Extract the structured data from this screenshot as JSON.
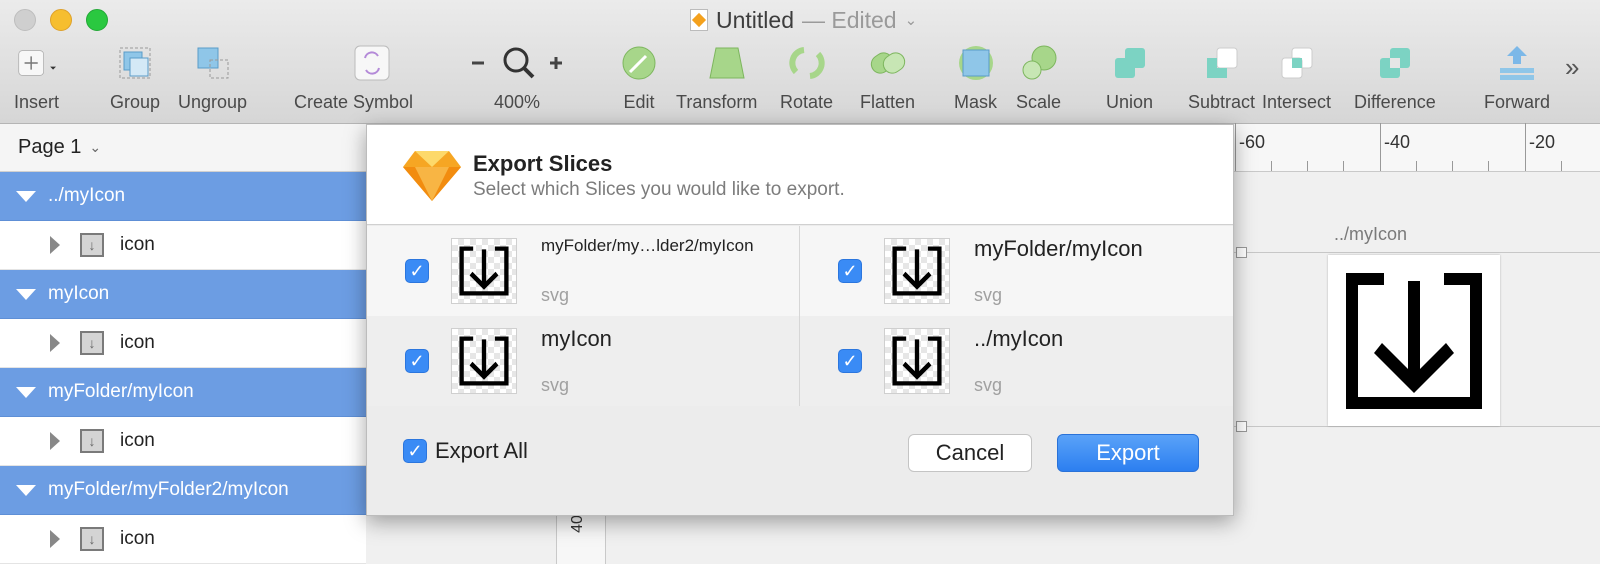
{
  "window": {
    "title": "Untitled",
    "edited": "— Edited"
  },
  "toolbar": {
    "insert": "Insert",
    "group": "Group",
    "ungroup": "Ungroup",
    "create_symbol": "Create Symbol",
    "zoom_level": "400%",
    "edit": "Edit",
    "transform": "Transform",
    "rotate": "Rotate",
    "flatten": "Flatten",
    "mask": "Mask",
    "scale": "Scale",
    "union": "Union",
    "subtract": "Subtract",
    "intersect": "Intersect",
    "difference": "Difference",
    "forward": "Forward"
  },
  "page_selector": "Page 1",
  "ruler": {
    "ticks": [
      "-60",
      "-40",
      "-20"
    ],
    "vertical": "40"
  },
  "layers": [
    {
      "name": "../myIcon",
      "child": "icon"
    },
    {
      "name": "myIcon",
      "child": "icon"
    },
    {
      "name": "myFolder/myIcon",
      "child": "icon"
    },
    {
      "name": "myFolder/myFolder2/myIcon",
      "child": "icon"
    }
  ],
  "canvas": {
    "artboard_label": "../myIcon"
  },
  "dialog": {
    "title": "Export Slices",
    "subtitle": "Select which Slices you would like to export.",
    "slices": [
      {
        "name": "myFolder/my…lder2/myIcon",
        "format": "svg"
      },
      {
        "name": "myFolder/myIcon",
        "format": "svg"
      },
      {
        "name": "myIcon",
        "format": "svg"
      },
      {
        "name": "../myIcon",
        "format": "svg"
      }
    ],
    "export_all": "Export All",
    "cancel": "Cancel",
    "export": "Export"
  },
  "colors": {
    "accent": "#3a8bf5",
    "layer_selected": "#6c9de3"
  }
}
